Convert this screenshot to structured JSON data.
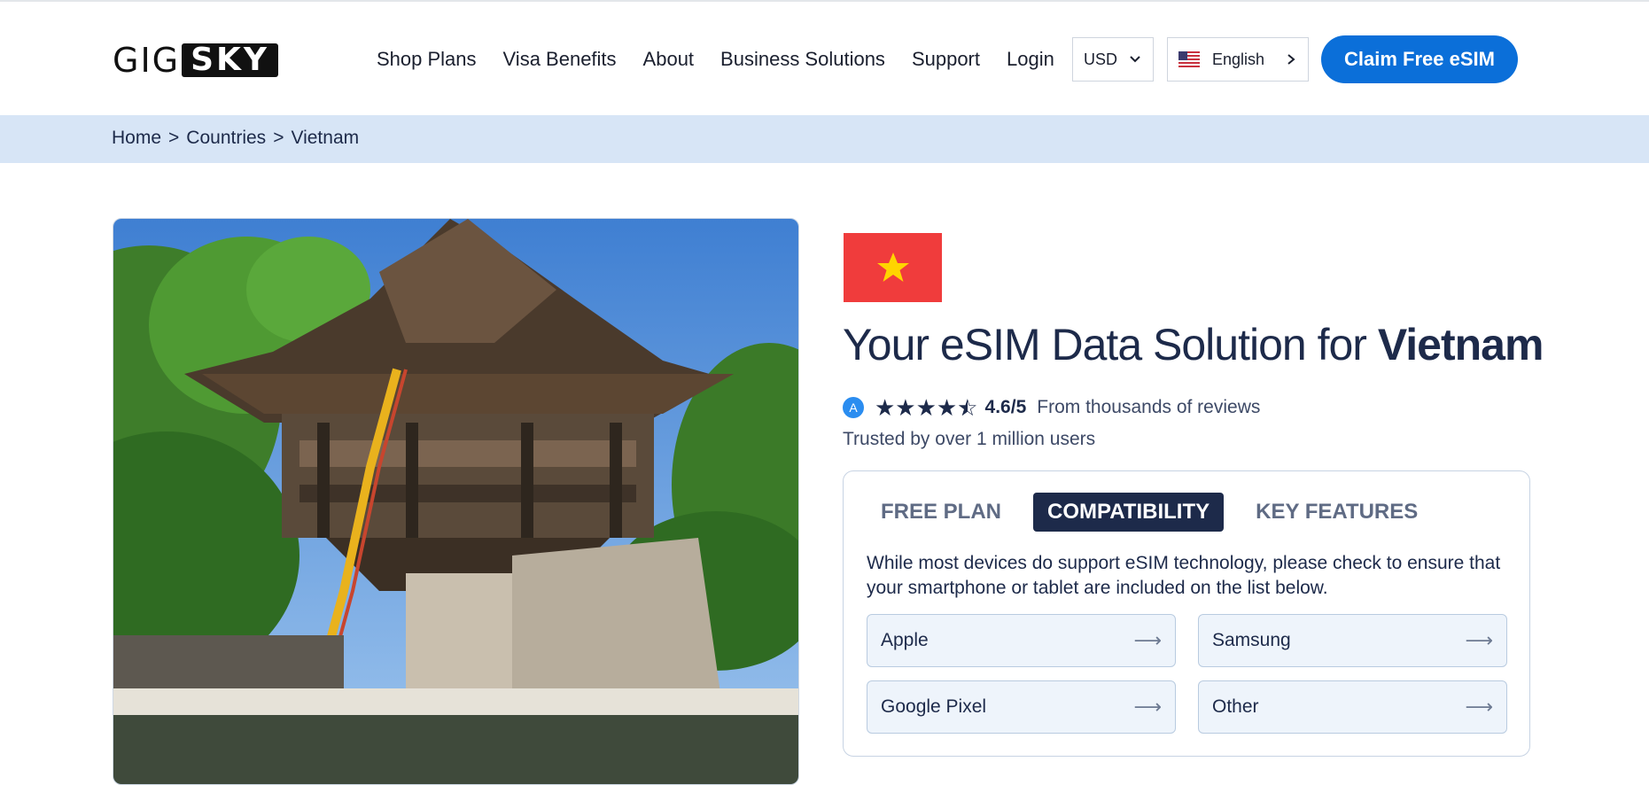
{
  "logo": {
    "part1": "GIG",
    "part2": "SKY"
  },
  "nav": [
    {
      "label": "Shop Plans"
    },
    {
      "label": "Visa Benefits"
    },
    {
      "label": "About"
    },
    {
      "label": "Business Solutions"
    },
    {
      "label": "Support"
    },
    {
      "label": "Login"
    }
  ],
  "currency": {
    "value": "USD"
  },
  "language": {
    "value": "English"
  },
  "cta": {
    "label": "Claim Free eSIM"
  },
  "breadcrumb": {
    "home": "Home",
    "sep": ">",
    "countries": "Countries",
    "current": "Vietnam"
  },
  "product": {
    "title_prefix": "Your eSIM Data Solution for ",
    "title_country": "Vietnam",
    "rating": "4.6/5",
    "reviews_text": "From thousands of reviews",
    "trusted": "Trusted by over 1 million users"
  },
  "tabs": [
    {
      "label": "FREE PLAN",
      "active": false
    },
    {
      "label": "COMPATIBILITY",
      "active": true
    },
    {
      "label": "KEY FEATURES",
      "active": false
    }
  ],
  "compatibility": {
    "description": "While most devices do support eSIM technology, please check to ensure that your smartphone or tablet are included on the list below.",
    "devices": [
      {
        "label": "Apple"
      },
      {
        "label": "Samsung"
      },
      {
        "label": "Google Pixel"
      },
      {
        "label": "Other"
      }
    ]
  },
  "colors": {
    "accent": "#0b6fd9",
    "navy": "#1d2a4a",
    "breadcrumb_bg": "#d7e5f6",
    "flag_red": "#f03c3c",
    "flag_star": "#ffd400"
  }
}
